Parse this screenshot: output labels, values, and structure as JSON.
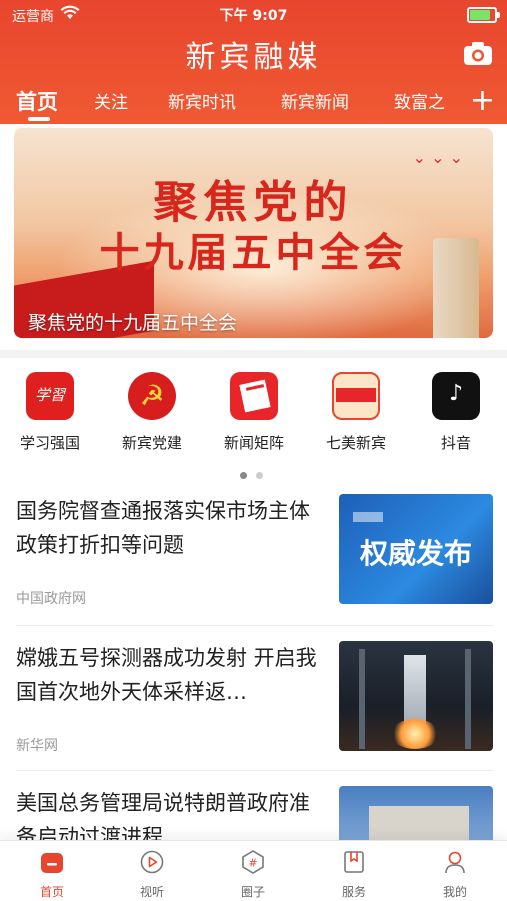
{
  "status": {
    "carrier": "运营商",
    "time": "下午 9:07",
    "battery_level": 0.9
  },
  "app": {
    "title": "新宾融媒"
  },
  "tabs": [
    {
      "label": "首页",
      "active": true
    },
    {
      "label": "关注"
    },
    {
      "label": "新宾时讯"
    },
    {
      "label": "新宾新闻"
    },
    {
      "label": "致富之"
    }
  ],
  "banner": {
    "headline1": "聚焦党的",
    "headline2": "十九届五中全会",
    "caption": "聚焦党的十九届五中全会",
    "slide_count": 8,
    "active_slide": 1
  },
  "shortcuts": [
    {
      "label": "学习强国",
      "icon": "xuexi-icon"
    },
    {
      "label": "新宾党建",
      "icon": "party-emblem-icon"
    },
    {
      "label": "新闻矩阵",
      "icon": "news-matrix-icon"
    },
    {
      "label": "七美新宾",
      "icon": "qimei-icon"
    },
    {
      "label": "抖音",
      "icon": "douyin-icon"
    }
  ],
  "shortcut_pages": {
    "count": 2,
    "active": 1
  },
  "news": [
    {
      "title": "国务院督查通报落实保市场主体政策打折扣等问题",
      "source": "中国政府网",
      "thumb_text": "权威发布"
    },
    {
      "title": "嫦娥五号探测器成功发射 开启我国首次地外天体采样返…",
      "source": "新华网",
      "thumb_text": ""
    },
    {
      "title": " 美国总务管理局说特朗普政府准备启动过渡进程",
      "source": "",
      "thumb_text": ""
    }
  ],
  "bottom_nav": [
    {
      "label": "首页",
      "icon": "home-icon",
      "active": true
    },
    {
      "label": "视听",
      "icon": "play-icon"
    },
    {
      "label": "圈子",
      "icon": "hashtag-icon"
    },
    {
      "label": "服务",
      "icon": "bookmark-icon"
    },
    {
      "label": "我的",
      "icon": "user-icon"
    }
  ],
  "colors": {
    "brand": "#e8452e",
    "banner_text": "#d7261b"
  }
}
